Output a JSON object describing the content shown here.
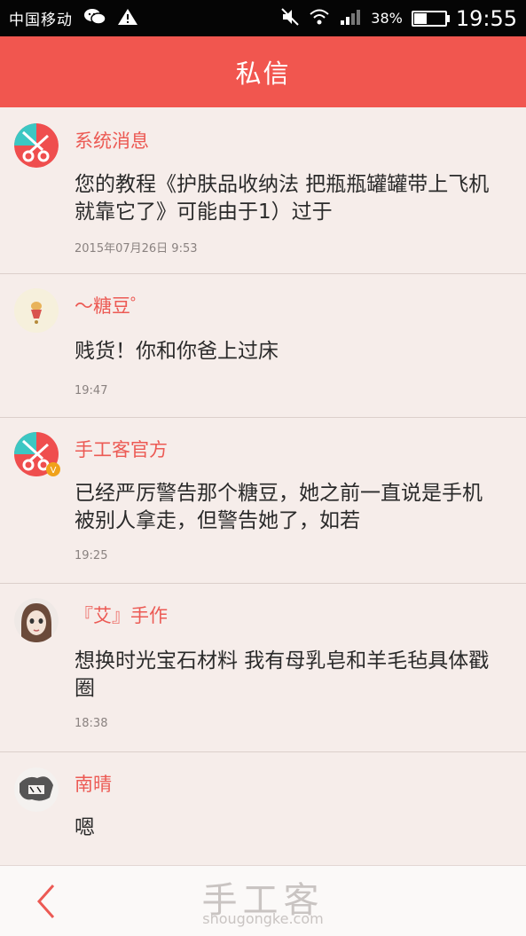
{
  "status_bar": {
    "carrier": "中国移动",
    "battery_percent_text": "38%",
    "battery_level": 0.38,
    "time": "19:55",
    "icons": [
      "wechat-icon",
      "warning-icon",
      "mute-icon",
      "wifi-icon",
      "signal-icon",
      "battery-icon"
    ]
  },
  "header": {
    "title": "私信"
  },
  "conversations": [
    {
      "name": "系统消息",
      "message": "您的教程《护肤品收纳法 把瓶瓶罐罐带上飞机就靠它了》可能由于1）过于",
      "time": "2015年07月26日 9:53",
      "avatar": "scissors-logo"
    },
    {
      "name": "～糖豆゜",
      "message": "贱货！你和你爸上过床",
      "time": "19:47",
      "avatar": "user-photo"
    },
    {
      "name": "手工客官方",
      "message": "已经严厉警告那个糖豆，她之前一直说是手机被别人拿走，但警告她了，如若",
      "time": "19:25",
      "avatar": "scissors-logo-verified"
    },
    {
      "name": "『艾』手作",
      "message": "想换时光宝石材料 我有母乳皂和羊毛毡具体戳圈",
      "time": "18:38",
      "avatar": "user-photo"
    },
    {
      "name": "南晴",
      "message": "嗯",
      "time": "",
      "avatar": "user-photo"
    }
  ],
  "bottom_bar": {
    "back_icon": "chevron-left-icon",
    "watermark_title": "手工客",
    "watermark_url": "shougongke.com",
    "accent_color": "#ec5a54"
  }
}
